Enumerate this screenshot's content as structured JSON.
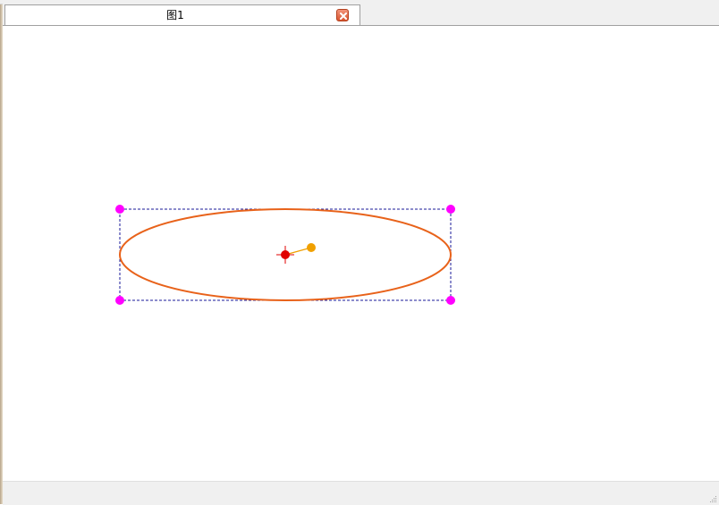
{
  "tab": {
    "title": "图1",
    "close_icon": "close-icon"
  },
  "colors": {
    "ellipse": "#e8621a",
    "selection_box": "#1a1a9a",
    "corner_handle": "#ff00ff",
    "center_handle": "#e00000",
    "rotate_handle": "#f0a000"
  }
}
